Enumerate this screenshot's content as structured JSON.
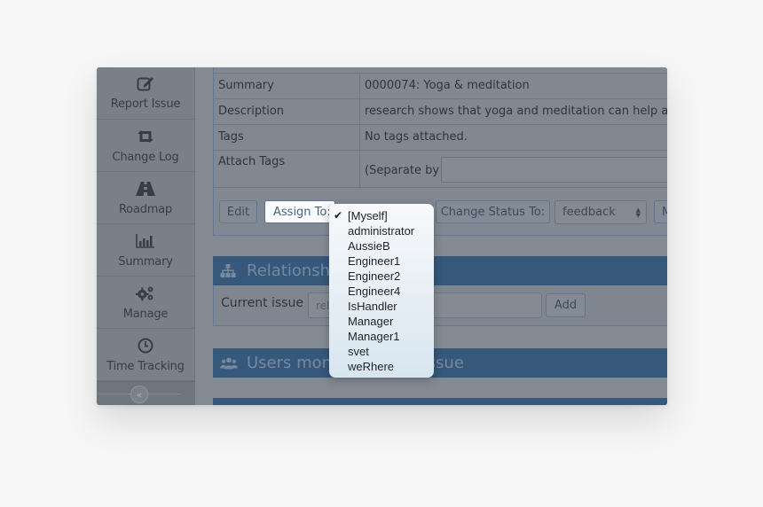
{
  "sidebar": {
    "items": [
      {
        "label": "Report Issue",
        "icon": "edit-icon"
      },
      {
        "label": "Change Log",
        "icon": "retweet-icon"
      },
      {
        "label": "Roadmap",
        "icon": "road-icon"
      },
      {
        "label": "Summary",
        "icon": "bar-chart-icon"
      },
      {
        "label": "Manage",
        "icon": "gears-icon"
      },
      {
        "label": "Time Tracking",
        "icon": "clock-icon"
      }
    ],
    "collapse_glyph": "«"
  },
  "issue": {
    "rows": [
      {
        "key": "Summary",
        "value": "0000074: Yoga & meditation"
      },
      {
        "key": "Description",
        "value": "research shows that yoga and meditation can help allevia"
      },
      {
        "key": "Tags",
        "value": "No tags attached."
      },
      {
        "key": "Attach Tags",
        "value": "(Separate by \",\")"
      }
    ],
    "tag_input_value": ""
  },
  "actions": {
    "edit_label": "Edit",
    "assign_label": "Assign To:",
    "change_status_label": "Change Status To:",
    "status_selected": "feedback",
    "more_label": "M"
  },
  "relationships": {
    "title": "Relationships",
    "current_issue_label": "Current issue",
    "input_value": "rel",
    "add_label": "Add"
  },
  "users_monitoring": {
    "title": "Users monitoring this issue"
  },
  "assign_dropdown": {
    "selected": "[Myself]",
    "options": [
      "[Myself]",
      "administrator",
      "AussieB",
      "Engineer1",
      "Engineer2",
      "Engineer4",
      "IsHandler",
      "Manager",
      "Manager1",
      "svet",
      "weRhere"
    ]
  }
}
